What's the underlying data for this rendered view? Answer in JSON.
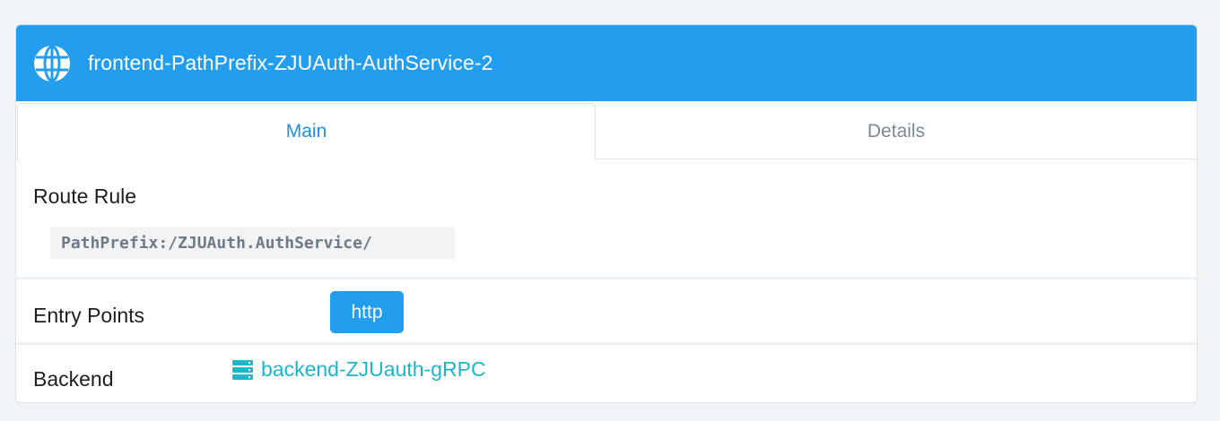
{
  "header": {
    "icon": "globe-icon",
    "title": "frontend-PathPrefix-ZJUAuth-AuthService-2",
    "background_color": "#239ded"
  },
  "tabs": [
    {
      "label": "Main",
      "active": true
    },
    {
      "label": "Details",
      "active": false
    }
  ],
  "route_rule": {
    "label": "Route Rule",
    "value": "PathPrefix:/ZJUAuth.AuthService/"
  },
  "entry_points": {
    "label": "Entry Points",
    "items": [
      "http"
    ]
  },
  "backend": {
    "label": "Backend",
    "icon": "server-icon",
    "value": "backend-ZJUauth-gRPC",
    "link_color": "#1bb7c9"
  }
}
